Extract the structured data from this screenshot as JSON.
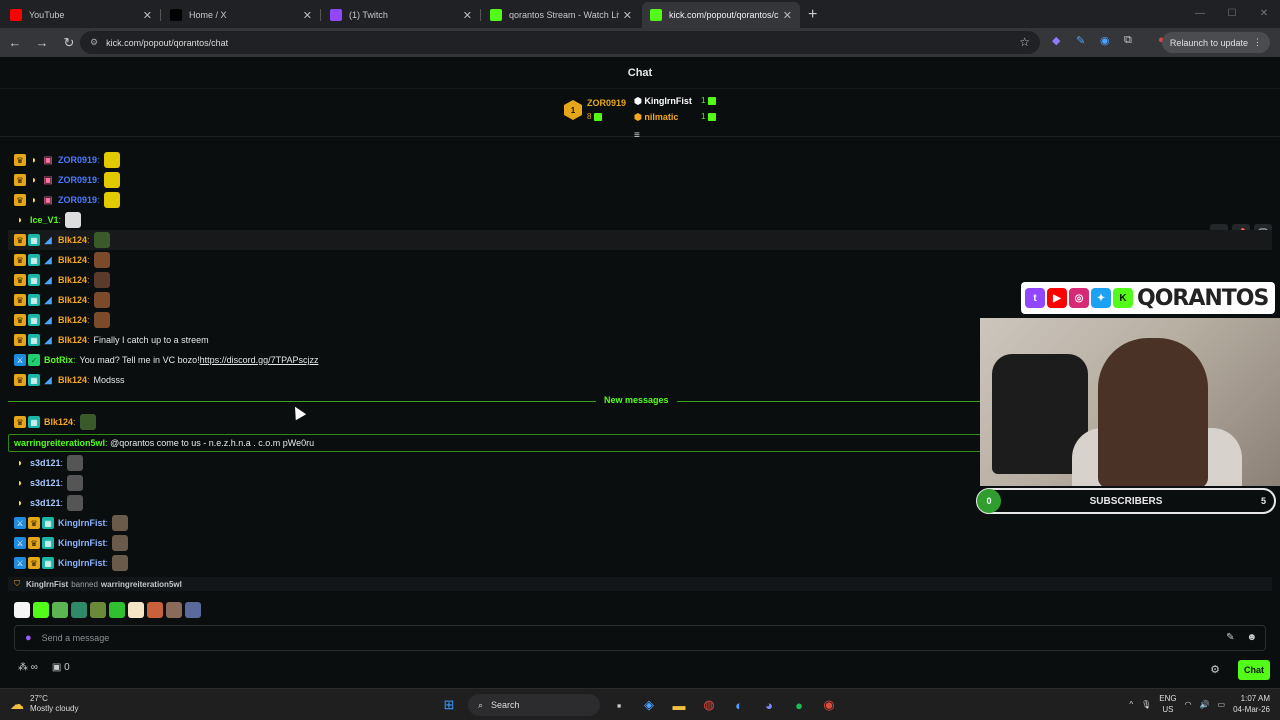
{
  "browser": {
    "tabs": [
      {
        "title": "YouTube",
        "color": "#ff0000",
        "active": false
      },
      {
        "title": "Home / X",
        "color": "#000000",
        "active": false
      },
      {
        "title": "(1) Twitch",
        "color": "#9146ff",
        "active": false
      },
      {
        "title": "qorantos Stream - Watch Live o",
        "color": "#53fc18",
        "active": false
      },
      {
        "title": "kick.com/popout/qorantos/cha",
        "color": "#53fc18",
        "active": true
      }
    ],
    "url": "kick.com/popout/qorantos/chat",
    "relaunch_label": "Relaunch to update"
  },
  "chat": {
    "title": "Chat",
    "leaderboard": {
      "top": {
        "rank": "1",
        "name": "ZOR0919",
        "gifts": "8"
      },
      "others": [
        {
          "name": "KingIrnFist",
          "gifts": "1",
          "color": "#ffffff"
        },
        {
          "name": "nilmatic",
          "gifts": "1",
          "color": "#f5a623"
        }
      ]
    },
    "messages": [
      {
        "user": "ZOR0919",
        "color": "#4a7bff",
        "badges": [
          "crown",
          "banana",
          "gift"
        ],
        "text": "",
        "emote": "#e2c900"
      },
      {
        "user": "ZOR0919",
        "color": "#4a7bff",
        "badges": [
          "crown",
          "banana",
          "gift"
        ],
        "text": "",
        "emote": "#e2c900"
      },
      {
        "user": "ZOR0919",
        "color": "#4a7bff",
        "badges": [
          "crown",
          "banana",
          "gift"
        ],
        "text": "",
        "emote": "#e2c900"
      },
      {
        "user": "Ice_V1",
        "color": "#53fc18",
        "badges": [
          "banana"
        ],
        "text": "",
        "emote": "#dddddd"
      },
      {
        "user": "Blk124",
        "color": "#f5a623",
        "badges": [
          "crown",
          "sub",
          "shark"
        ],
        "text": "",
        "emote": "#3b5a2a",
        "highlight": true
      },
      {
        "user": "Blk124",
        "color": "#f5a623",
        "badges": [
          "crown",
          "sub",
          "shark"
        ],
        "text": "",
        "emote": "#7a4a2a"
      },
      {
        "user": "Blk124",
        "color": "#f5a623",
        "badges": [
          "crown",
          "sub",
          "shark"
        ],
        "text": "",
        "emote": "#5a3a2a"
      },
      {
        "user": "Blk124",
        "color": "#f5a623",
        "badges": [
          "crown",
          "sub",
          "shark"
        ],
        "text": "",
        "emote": "#7a4a2a"
      },
      {
        "user": "Blk124",
        "color": "#f5a623",
        "badges": [
          "crown",
          "sub",
          "shark"
        ],
        "text": "",
        "emote": "#7a4a2a"
      },
      {
        "user": "Blk124",
        "color": "#f5a623",
        "badges": [
          "crown",
          "sub",
          "shark"
        ],
        "text": "Finally I catch up to a streem"
      },
      {
        "user": "BotRix",
        "color": "#53fc18",
        "badges": [
          "mod",
          "ver"
        ],
        "text": "You mad? Tell me in VC bozo! ",
        "link": "https://discord.gg/7TPAPscjzz"
      },
      {
        "user": "Blk124",
        "color": "#f5a623",
        "badges": [
          "crown",
          "sub",
          "shark"
        ],
        "text": "Modsss"
      }
    ],
    "new_messages_label": "New messages",
    "after": [
      {
        "user": "Blk124",
        "color": "#f5a623",
        "badges": [
          "crown",
          "sub"
        ],
        "text": "",
        "emote": "#3b5a2a"
      },
      {
        "user": "s3d121",
        "color": "#a8c8ff",
        "badges": [
          "banana"
        ],
        "text": "",
        "emote": "#555555"
      },
      {
        "user": "s3d121",
        "color": "#a8c8ff",
        "badges": [
          "banana"
        ],
        "text": "",
        "emote": "#555555"
      },
      {
        "user": "s3d121",
        "color": "#a8c8ff",
        "badges": [
          "banana"
        ],
        "text": "",
        "emote": "#555555"
      },
      {
        "user": "KingIrnFist",
        "color": "#8ab4ff",
        "badges": [
          "mod",
          "crown",
          "sub"
        ],
        "text": "",
        "emote": "#6a5a4a"
      },
      {
        "user": "KingIrnFist",
        "color": "#8ab4ff",
        "badges": [
          "mod",
          "crown",
          "sub"
        ],
        "text": "",
        "emote": "#6a5a4a"
      },
      {
        "user": "KingIrnFist",
        "color": "#8ab4ff",
        "badges": [
          "mod",
          "crown",
          "sub"
        ],
        "text": "",
        "emote": "#6a5a4a"
      }
    ],
    "flagged": {
      "user": "warringreiteration5wl",
      "text": "@qorantos come to us - n.e.z.h.n.a . c.o.m pWe0ru"
    },
    "ban": {
      "moderator": "KingIrnFist",
      "action": "banned",
      "target": "warringreiteration5wl"
    },
    "input_placeholder": "Send a message",
    "points": "0",
    "chat_button": "Chat"
  },
  "overlay": {
    "brand": "QORANTOS",
    "subs_label": "SUBSCRIBERS",
    "subs_current": "0",
    "subs_goal": "5"
  },
  "taskbar": {
    "temp": "27°C",
    "weather": "Mostly cloudy",
    "search": "Search",
    "lang1": "ENG",
    "lang2": "US",
    "time": "1:07 AM",
    "date": "04-Mar-26"
  }
}
